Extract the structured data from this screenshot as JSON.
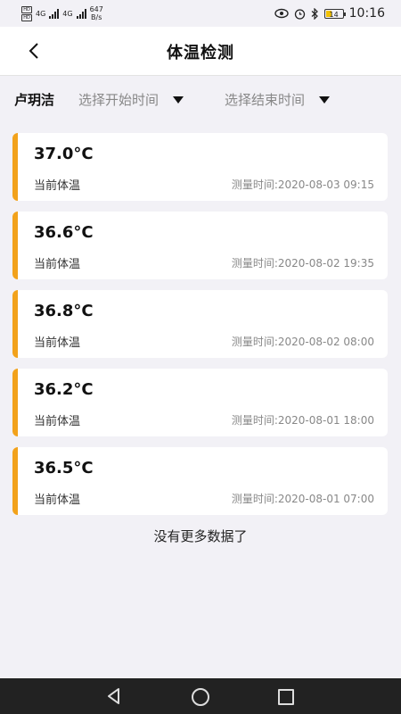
{
  "statusbar": {
    "sim1": "HD",
    "sim2": "HD",
    "net1": "4G",
    "net2": "4G",
    "speed_value": "647",
    "speed_unit": "B/s",
    "battery_level": "14",
    "time": "10:16"
  },
  "header": {
    "title": "体温检测",
    "back_icon": "chevron-left-icon"
  },
  "filter": {
    "user": "卢玥洁",
    "start_placeholder": "选择开始时间",
    "end_placeholder": "选择结束时间"
  },
  "records": [
    {
      "temp": "37.0°C",
      "label": "当前体温",
      "time": "测量时间:2020-08-03 09:15"
    },
    {
      "temp": "36.6°C",
      "label": "当前体温",
      "time": "测量时间:2020-08-02 19:35"
    },
    {
      "temp": "36.8°C",
      "label": "当前体温",
      "time": "测量时间:2020-08-02 08:00"
    },
    {
      "temp": "36.2°C",
      "label": "当前体温",
      "time": "测量时间:2020-08-01 18:00"
    },
    {
      "temp": "36.5°C",
      "label": "当前体温",
      "time": "测量时间:2020-08-01 07:00"
    }
  ],
  "no_more": "没有更多数据了",
  "colors": {
    "accent": "#f2a21b",
    "background": "#f2f1f6",
    "navbar": "#222222"
  }
}
